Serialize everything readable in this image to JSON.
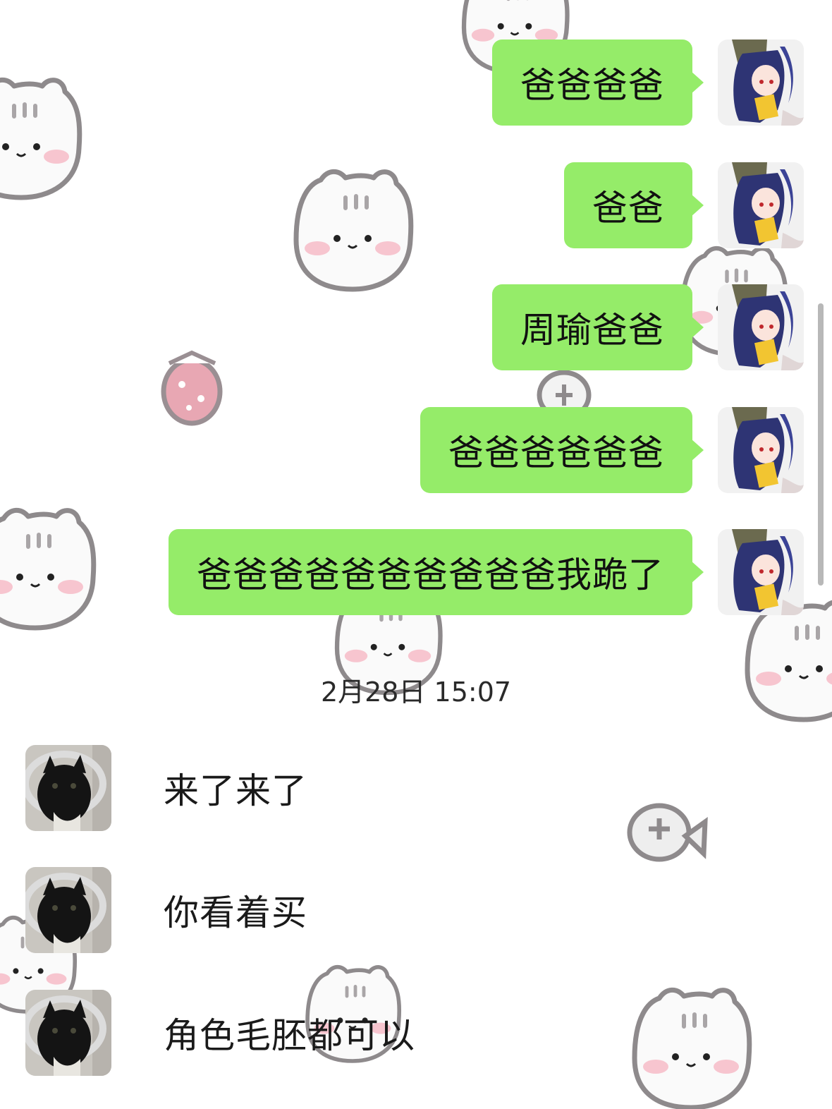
{
  "outgoing": [
    {
      "text": "爸爸爸爸"
    },
    {
      "text": "爸爸"
    },
    {
      "text": "周瑜爸爸"
    },
    {
      "text": "爸爸爸爸爸爸"
    },
    {
      "text": "爸爸爸爸爸爸爸爸爸爸我跪了"
    }
  ],
  "timestamp": "2月28日 15:07",
  "incoming": [
    {
      "text": "来了来了"
    },
    {
      "text": "你看着买"
    },
    {
      "text": "角色毛胚都可以"
    }
  ],
  "colors": {
    "bubble_out": "#95ec69",
    "background": "#ffffff",
    "doodle": "#8e8a8c"
  },
  "icons": {
    "wallpaper": "cat-face-doodle-icon",
    "strawberry": "strawberry-icon",
    "fish": "fish-icon"
  }
}
